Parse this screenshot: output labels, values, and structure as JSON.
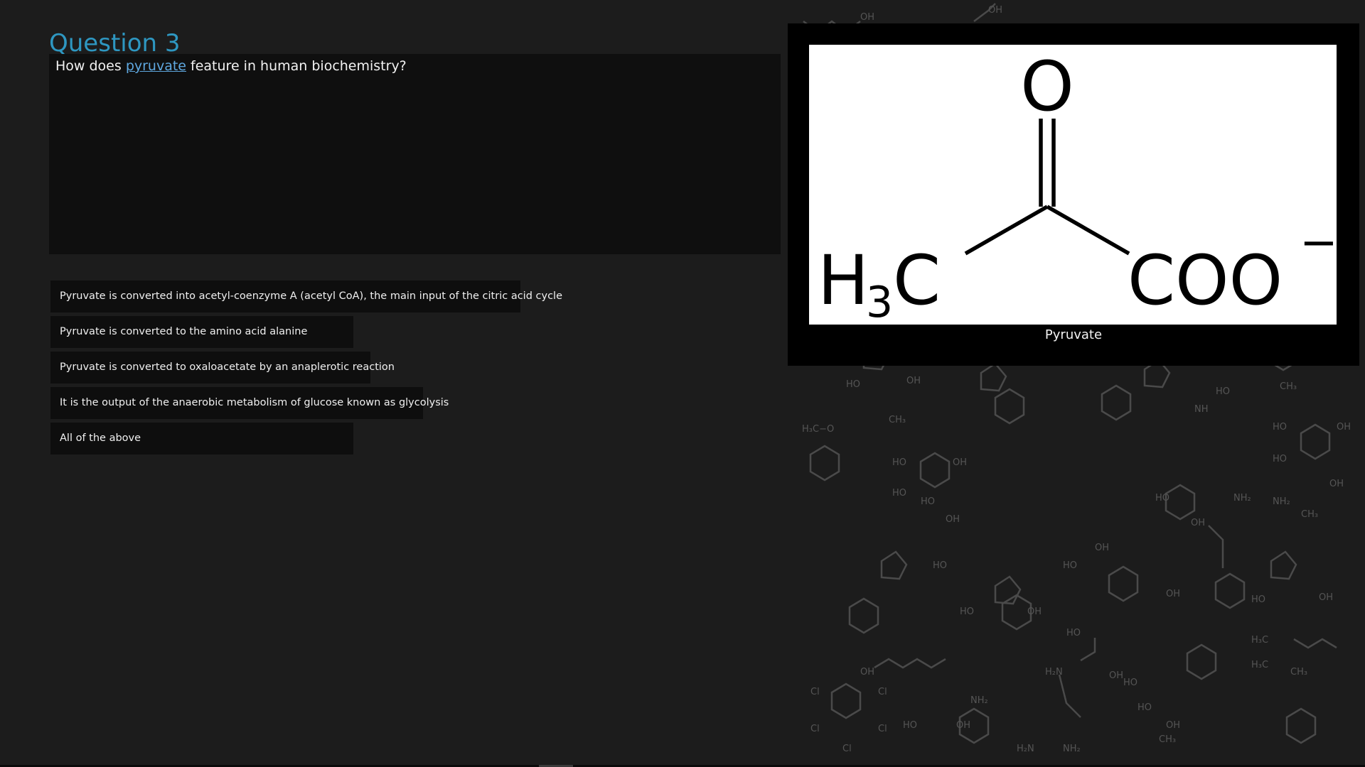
{
  "question": {
    "title": "Question 3",
    "text_before": "How does ",
    "link_text": "pyruvate",
    "text_after": " feature in human biochemistry?"
  },
  "answers": [
    {
      "label": "Pyruvate is converted into acetyl-coenzyme A (acetyl CoA), the main input of the citric acid cycle"
    },
    {
      "label": "Pyruvate is converted to the amino acid alanine"
    },
    {
      "label": "Pyruvate is converted to oxaloacetate by an anaplerotic reaction"
    },
    {
      "label": "It is the output of the anaerobic metabolism of glucose known as glycolysis"
    },
    {
      "label": "All of the above"
    }
  ],
  "image": {
    "caption": "Pyruvate",
    "formula_left": "H",
    "formula_left_sub": "3",
    "formula_left_c": "C",
    "formula_top": "O",
    "formula_right": "COO",
    "formula_charge": "−"
  },
  "colors": {
    "accent": "#2e97c1",
    "link": "#5fa8e0",
    "background": "#1c1c1c",
    "answer_bg": "#0e0e0e"
  }
}
